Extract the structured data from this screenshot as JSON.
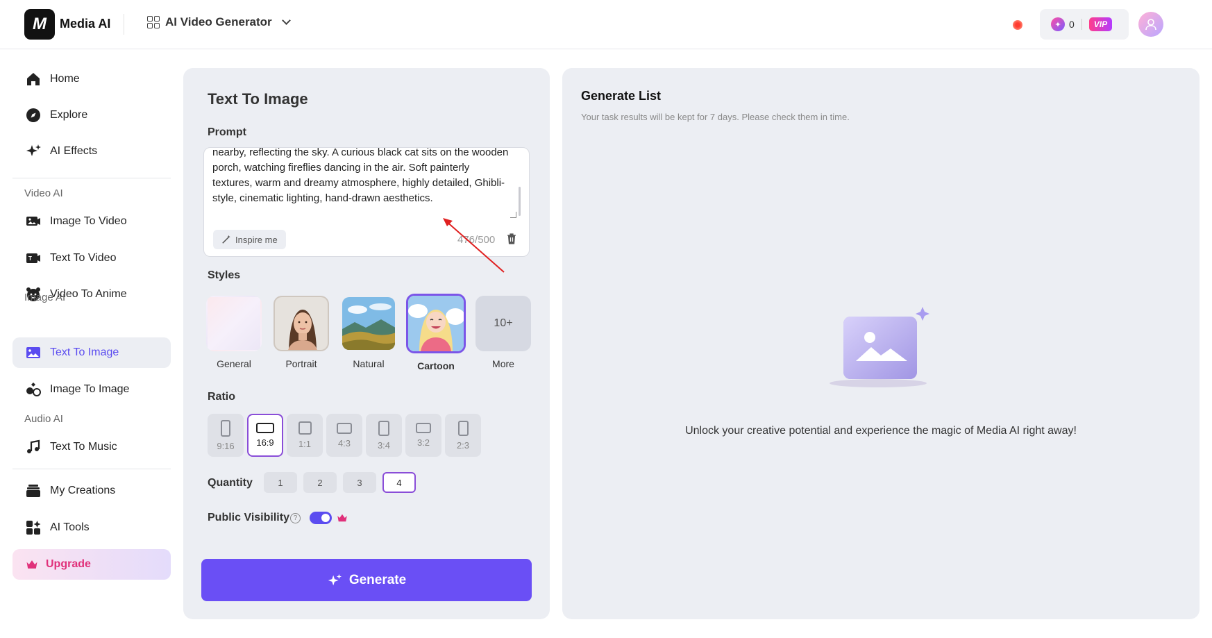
{
  "header": {
    "logo_text": "M",
    "brand": "Media AI",
    "app_switch_label": "AI Video Generator",
    "credits": "0",
    "vip_label": "VIP"
  },
  "sidebar": {
    "home": "Home",
    "explore": "Explore",
    "ai_effects": "AI Effects",
    "section_video": "Video AI",
    "image_to_video": "Image To Video",
    "text_to_video": "Text To Video",
    "video_to_anime": "Video To Anime",
    "section_image": "Image AI",
    "text_to_image": "Text To Image",
    "image_to_image": "Image To Image",
    "section_audio": "Audio AI",
    "text_to_music": "Text To Music",
    "my_creations": "My Creations",
    "ai_tools": "AI Tools",
    "upgrade": "Upgrade"
  },
  "form": {
    "title": "Text To Image",
    "prompt_label": "Prompt",
    "prompt_text": "nearby, reflecting the sky. A curious black cat sits on the wooden porch, watching fireflies dancing in the air. Soft painterly textures, warm and dreamy atmosphere, highly detailed, Ghibli-style, cinematic lighting, hand-drawn aesthetics.",
    "inspire_label": "Inspire me",
    "char_count": "476/500",
    "styles_label": "Styles",
    "styles": [
      {
        "name": "General"
      },
      {
        "name": "Portrait"
      },
      {
        "name": "Natural"
      },
      {
        "name": "Cartoon"
      },
      {
        "name": "More",
        "thumb_text": "10+"
      }
    ],
    "selected_style": "Cartoon",
    "ratio_label": "Ratio",
    "ratios": [
      "9:16",
      "16:9",
      "1:1",
      "4:3",
      "3:4",
      "3:2",
      "2:3"
    ],
    "selected_ratio": "16:9",
    "quantity_label": "Quantity",
    "quantities": [
      "1",
      "2",
      "3",
      "4"
    ],
    "selected_quantity": "4",
    "visibility_label": "Public Visibility",
    "visibility_help": "?",
    "public_visibility_on": true,
    "generate_label": "Generate"
  },
  "generate_list": {
    "title": "Generate List",
    "subtitle": "Your task results will be kept for 7 days. Please check them in time.",
    "empty_message": "Unlock your creative potential and experience the magic of Media AI right away!"
  },
  "colors": {
    "accent": "#6a4ff5",
    "selected_border": "#8a4dd8",
    "upgrade_text": "#e0307a",
    "annotation_arrow": "#e02020"
  }
}
